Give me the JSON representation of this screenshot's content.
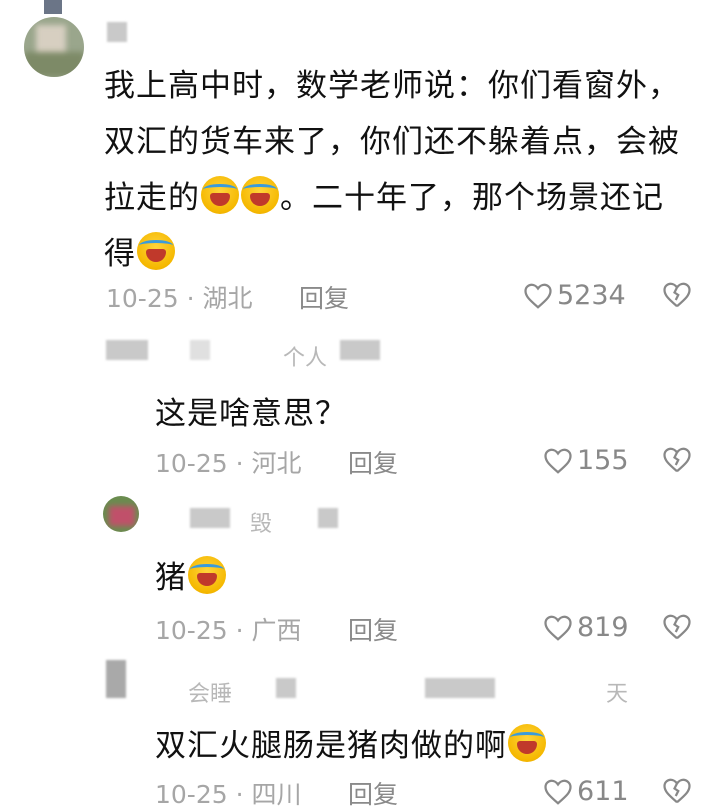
{
  "comments": [
    {
      "text_lines": [
        "我上高中时，数学老师说：你们看窗外，",
        "双汇的货车来了，你们还不躲着点，会被",
        "拉走的",
        "。二十年了，那个场景还记",
        "得"
      ],
      "date": "10-25 · 湖北",
      "reply": "回复",
      "likes": "5234"
    },
    {
      "user_partial": "个人",
      "text": "这是啥意思？",
      "date": "10-25 · 河北",
      "reply": "回复",
      "likes": "155"
    },
    {
      "user_partial": "毁",
      "text": "猪",
      "date": "10-25 · 广西",
      "reply": "回复",
      "likes": "819"
    },
    {
      "user_partial_a": "会睡",
      "user_partial_b": "天",
      "text": "双汇火腿肠是猪肉做的啊",
      "date": "10-25 · 四川",
      "reply": "回复",
      "likes": "611"
    }
  ],
  "icons": {
    "like": "heart-outline-icon",
    "dislike": "broken-heart-icon",
    "emoji": "laugh-cry-emoji"
  },
  "colors": {
    "meta_gray": "#a6a6a6",
    "text": "#111111"
  }
}
